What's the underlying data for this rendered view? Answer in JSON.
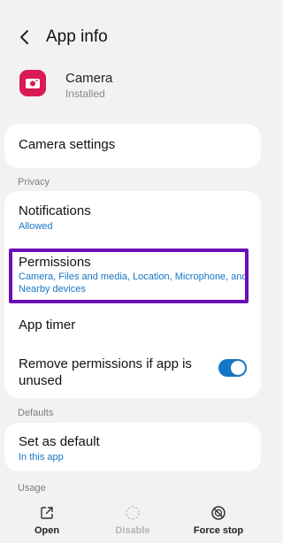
{
  "header": {
    "title": "App info",
    "back_icon": "back-arrow-icon"
  },
  "app": {
    "name": "Camera",
    "status": "Installed",
    "icon": "camera-icon",
    "icon_color": "#d81b52"
  },
  "rows": {
    "camera_settings": "Camera settings",
    "notifications_title": "Notifications",
    "notifications_sub": "Allowed",
    "permissions_title": "Permissions",
    "permissions_sub": "Camera, Files and media, Location, Microphone, and Nearby devices",
    "app_timer": "App timer",
    "remove_permissions": "Remove permissions if app is unused",
    "set_default_title": "Set as default",
    "set_default_sub": "In this app"
  },
  "sections": {
    "privacy": "Privacy",
    "defaults": "Defaults",
    "usage": "Usage"
  },
  "toggle": {
    "remove_permissions_on": true,
    "color": "#1576c5"
  },
  "highlight_color": "#6b0fb8",
  "bottom_bar": {
    "open": "Open",
    "disable": "Disable",
    "force_stop": "Force stop"
  }
}
